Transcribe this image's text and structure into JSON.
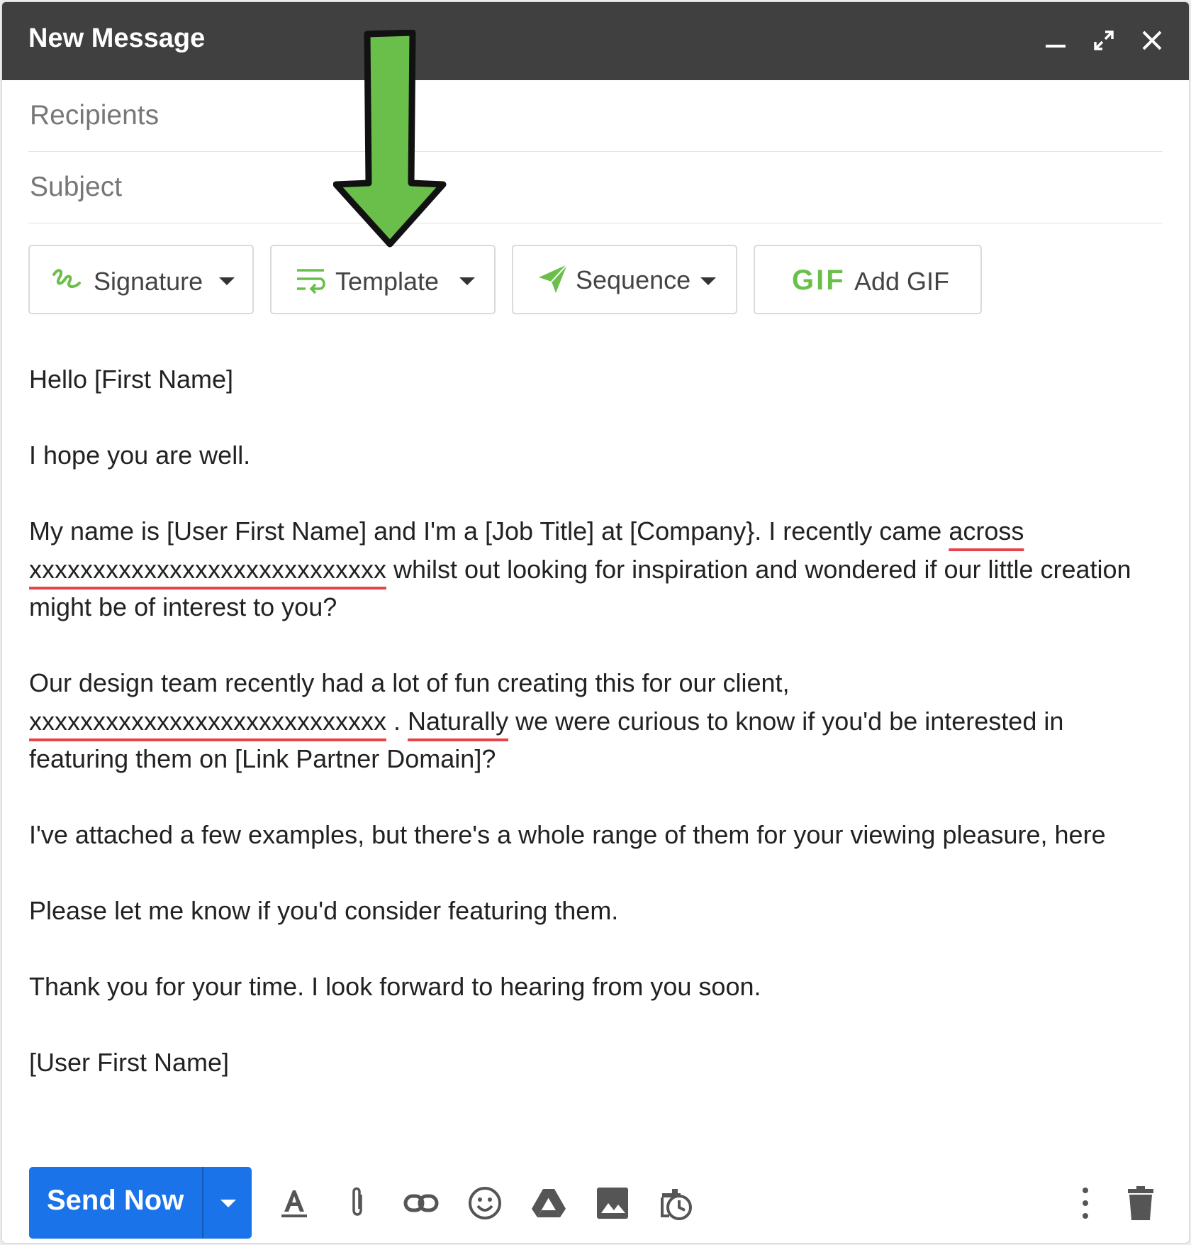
{
  "window": {
    "title": "New Message",
    "controls": [
      "minimize-icon",
      "expand-icon",
      "close-icon"
    ]
  },
  "fields": {
    "recipients_placeholder": "Recipients",
    "subject_placeholder": "Subject"
  },
  "toolbar": {
    "signature_label": "Signature",
    "template_label": "Template",
    "sequence_label": "Sequence",
    "gif_icon_text": "GIF",
    "add_gif_label": "Add GIF"
  },
  "body": {
    "greeting": "Hello [First Name]",
    "line1": "I hope you are well.",
    "p2_a": "My name is [User First Name] and I'm a [Job Title] at [Company}. I recently came ",
    "p2_across": "across",
    "p2_x": "xxxxxxxxxxxxxxxxxxxxxxxxxxxx",
    "p2_b": " whilst out looking for inspiration and wondered if our little creation might be of interest to you?",
    "p3_a": "Our design team recently had a lot of fun creating this for our client, ",
    "p3_x": "xxxxxxxxxxxxxxxxxxxxxxxxxxxx",
    "p3_dot": " . ",
    "p3_naturally": "Naturally",
    "p3_b": " we were curious to know if you'd be interested in featuring them on [Link Partner Domain]?",
    "p4": "I've attached a few examples, but there's a whole range of them for your viewing pleasure, here",
    "p5": "Please let me know if you'd consider featuring them.",
    "p6": "Thank you for your time. I look forward to hearing from you soon.",
    "p7": "[User First Name]"
  },
  "footer": {
    "send_label": "Send Now",
    "icons": [
      "format-text-icon",
      "attach-icon",
      "link-icon",
      "emoji-icon",
      "drive-icon",
      "image-icon",
      "schedule-icon",
      "more-options-icon",
      "delete-icon"
    ]
  },
  "colors": {
    "titlebar": "#404040",
    "accent_green": "#6abf4b",
    "send_blue": "#1a73e8",
    "spell_red": "#e8434a"
  }
}
